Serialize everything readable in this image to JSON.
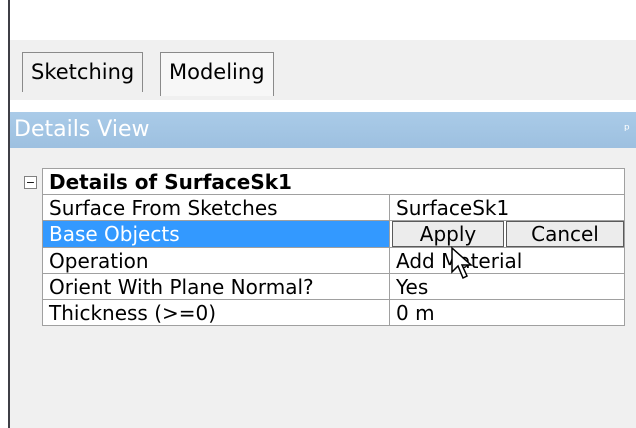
{
  "tabs": {
    "sketching": "Sketching",
    "modeling": "Modeling"
  },
  "details_view": {
    "title": "Details View",
    "pin_icon": "pin-icon",
    "rows": {
      "header": "Details of SurfaceSk1",
      "surface": {
        "label": "Surface From Sketches",
        "value": "SurfaceSk1"
      },
      "base": {
        "label": "Base Objects",
        "apply": "Apply",
        "cancel": "Cancel"
      },
      "operation": {
        "label": "Operation",
        "value": "Add Material"
      },
      "orient": {
        "label": "Orient With Plane Normal?",
        "value": "Yes"
      },
      "thickness": {
        "label": "Thickness (>=0)",
        "value": "0 m"
      }
    }
  },
  "colors": {
    "header_blue": "#9dc0e0",
    "selection_blue": "#3399ff"
  }
}
